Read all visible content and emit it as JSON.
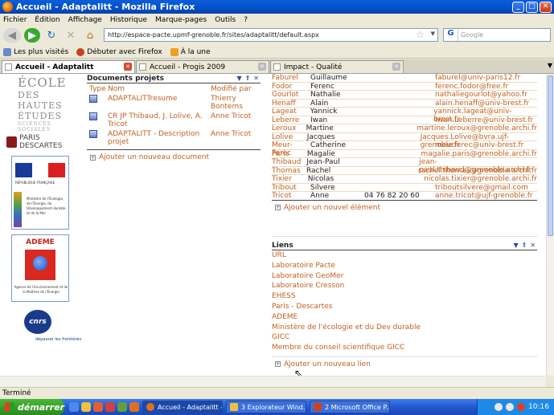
{
  "window": {
    "title": "Accueil - Adaptalitt - Mozilla Firefox"
  },
  "menu": [
    "Fichier",
    "Édition",
    "Affichage",
    "Historique",
    "Marque-pages",
    "Outils",
    "?"
  ],
  "address": {
    "url": "http://espace-pacte.upmf-grenoble.fr/sites/adaptalitt/default.aspx"
  },
  "search": {
    "placeholder": "Google"
  },
  "bookmarks": [
    {
      "label": "Les plus visités"
    },
    {
      "label": "Débuter avec Firefox"
    },
    {
      "label": "À la une"
    }
  ],
  "tabs": [
    {
      "label": "Accueil - Adaptalitt",
      "active": true
    },
    {
      "label": "Accueil - Progis 2009",
      "active": false
    },
    {
      "label": "Impact - Qualité",
      "active": false
    }
  ],
  "logos": {
    "ehess": {
      "line1": "ÉCOLE",
      "line2": "DES HAUTES ÉTUDES",
      "line3": "SCIENCES SOCIALES"
    },
    "paris": "PARIS DESCARTES",
    "rf": {
      "text": "RÉPUBLIQUE FRANÇAISE",
      "ministry": "Ministère de l'Écologie, de l'Énergie, du Développement durable et de la Mer"
    },
    "ademe": {
      "title": "ADEME",
      "sub": "Agence de l'Environnement et de la Maîtrise de l'Énergie"
    },
    "cnrs": {
      "title": "cnrs",
      "tag": "dépasser les frontières"
    }
  },
  "documents": {
    "title": "Documents projets",
    "col_type": "Type",
    "col_name": "Nom",
    "col_modified": "Modifié par",
    "rows": [
      {
        "name": "ADAPTALITTresume",
        "by": "Thierry Bontems"
      },
      {
        "name": "CR JP Thibaud, J. Lolive, A. Tricot",
        "by": "Anne Tricot"
      },
      {
        "name": "ADAPTALITT - Description projet",
        "by": "Anne Tricot"
      }
    ],
    "add": "Ajouter un nouveau document"
  },
  "members": {
    "rows": [
      {
        "last": "Faburel",
        "first": "Guillaume",
        "phone": "",
        "email": "faburel@univ-paris12.fr"
      },
      {
        "last": "Fodor",
        "first": "Ferenc",
        "phone": "",
        "email": "ferenc.fodor@free.fr"
      },
      {
        "last": "Gourlot",
        "first": "Nathalie",
        "phone": "",
        "email": "nathaliegourlot@yahoo.fr"
      },
      {
        "last": "Henaff",
        "first": "Alain",
        "phone": "",
        "email": "alain.henaff@univ-brest.fr"
      },
      {
        "last": "Lageat",
        "first": "Yannick",
        "phone": "",
        "email": "yannick.lageat@univ-brest.fr"
      },
      {
        "last": "Leberre",
        "first": "Iwan",
        "phone": "",
        "email": "Iwan.Leberre@univ-brest.fr"
      },
      {
        "last": "Leroux",
        "first": "Martine",
        "phone": "",
        "email": "martine.leroux@grenoble.archi.fr"
      },
      {
        "last": "Lolive",
        "first": "Jacques",
        "phone": "",
        "email": "Jacques.Lolive@bvra.ujf-grenoble.fr"
      },
      {
        "last": "Meur-Ferec",
        "first": "Catherine",
        "phone": "",
        "email": "meurferec@univ-brest.fr"
      },
      {
        "last": "Paris",
        "first": "Magalie",
        "phone": "",
        "email": "magalie.paris@grenoble.archi.fr"
      },
      {
        "last": "Thibaud",
        "first": "Jean-Paul",
        "phone": "",
        "email": "jean-paul.thibaud@grenoble.archi.fr"
      },
      {
        "last": "Thomas",
        "first": "Rachel",
        "phone": "",
        "email": "rachel.thomas@grenoble.archi.fr"
      },
      {
        "last": "Tixier",
        "first": "Nicolas",
        "phone": "",
        "email": "nicolas.tixier@grenoble.archi.fr"
      },
      {
        "last": "Tribout",
        "first": "Silvere",
        "phone": "",
        "email": "triboutsilvere@gmail.com"
      },
      {
        "last": "Tricot",
        "first": "Anne",
        "phone": "04 76 82 20 60",
        "email": "anne.tricot@ujf-grenoble.fr"
      }
    ],
    "add": "Ajouter un nouvel élément"
  },
  "liens": {
    "title": "Liens",
    "items": [
      "URL",
      "Laboratoire Pacte",
      "Laboratoire GeoMer",
      "Laboratoire Cresson",
      "EHESS",
      "Paris - Descartes",
      "ADEME",
      "Ministère de l'écologie et du Dev durable",
      "GICC",
      "Membre du conseil scientifique GICC"
    ],
    "add": "Ajouter un nouveau lien"
  },
  "status": "Terminé",
  "taskbar": {
    "start": "démarrer",
    "tasks": [
      {
        "label": "Accueil - Adaptalitt - ..."
      },
      {
        "label": "3 Explorateur Wind..."
      },
      {
        "label": "2 Microsoft Office P..."
      }
    ],
    "clock": "10:16"
  }
}
